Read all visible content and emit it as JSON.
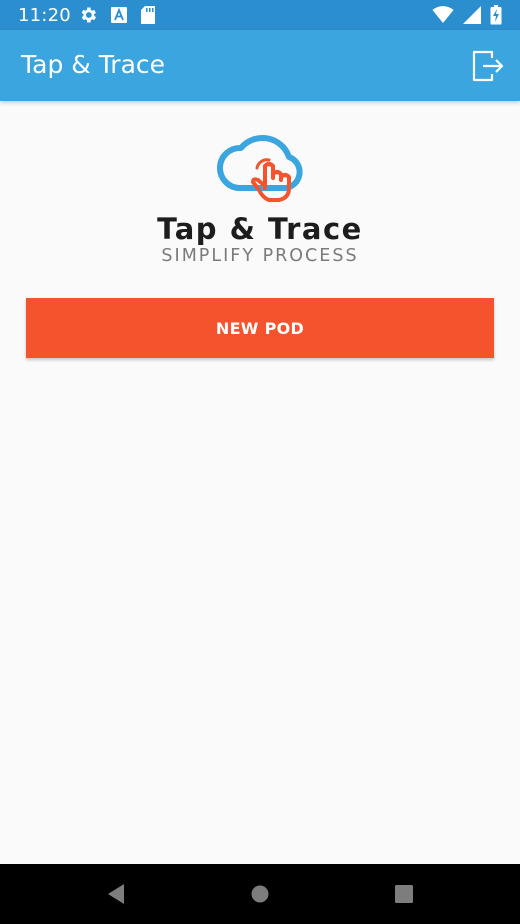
{
  "status_bar": {
    "time": "11:20",
    "icons_left": [
      "gear-icon",
      "a-icon",
      "sd-card-icon"
    ],
    "icons_right": [
      "wifi-icon",
      "signal-icon",
      "battery-icon"
    ]
  },
  "app_bar": {
    "title": "Tap & Trace",
    "action_icon": "logout-icon"
  },
  "logo": {
    "name": "Tap & Trace",
    "tagline": "SIMPLIFY PROCESS",
    "cloud_color": "#3ba5e0",
    "hand_color": "#f4532d"
  },
  "main": {
    "new_pod_label": "NEW POD"
  },
  "colors": {
    "status_bar": "#2b8fcf",
    "app_bar": "#3ba5e0",
    "accent": "#f4532d",
    "background": "#fafafa"
  },
  "nav_bar": {
    "buttons": [
      "back-icon",
      "home-icon",
      "recents-icon"
    ]
  }
}
